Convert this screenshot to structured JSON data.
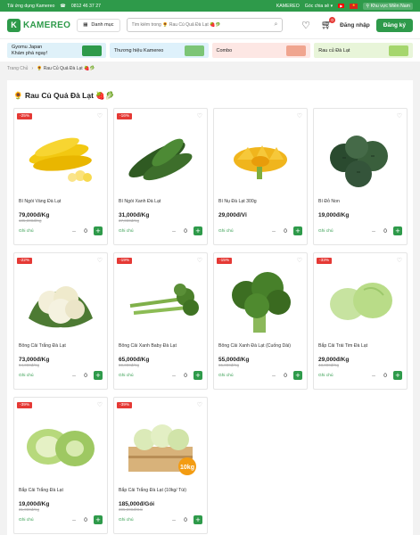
{
  "topbar": {
    "app_download": "Tải ứng dụng Kamereo",
    "phone": "0812 46 37 27",
    "brand": "KAMEREO",
    "corner": "Góc chia sẻ",
    "region": "Khu vực Miền Nam"
  },
  "header": {
    "logo_text": "KAMEREO",
    "menu_label": "Danh mục",
    "search_placeholder": "Tìm kiếm trong 🌻 Rau Củ Quả Đà Lạt 🍓🥬",
    "cart_count": "0",
    "login_label": "Đăng nhập",
    "register_label": "Đăng ký"
  },
  "banners": [
    {
      "line1": "Gyomu Japan",
      "line2": "Khám phá ngay!",
      "accent": "#2e9a4a"
    },
    {
      "line1": "Thương hiệu Kamereo",
      "line2": "",
      "accent": "#4caf50"
    },
    {
      "line1": "Combo",
      "line2": "",
      "accent": "#e57373"
    },
    {
      "line1": "Rau củ Đà Lạt",
      "line2": "",
      "accent": "#8bc34a"
    }
  ],
  "breadcrumb": {
    "home": "Trang Chủ",
    "current": "🌻 Rau Củ Quả Đà Lạt 🍓🥬"
  },
  "section_title": "🌻 Rau Củ Quả Đà Lạt 🍓🥬",
  "product_labels": {
    "note": "Ghi chú"
  },
  "products": [
    {
      "name": "Bí Ngòi Vàng Đà Lạt",
      "price": "79,000đ/Kg",
      "old_price": "105,000đ/Kg",
      "discount": "-25%",
      "qty": "0",
      "image": "yellow-zucchini"
    },
    {
      "name": "Bí Ngòi Xanh Đà Lạt",
      "price": "31,000đ/Kg",
      "old_price": "37,000đ/Kg",
      "discount": "-16%",
      "qty": "0",
      "image": "green-zucchini"
    },
    {
      "name": "Bí Nụ Đà Lạt 300g",
      "price": "29,000đ/Vỉ",
      "old_price": "",
      "discount": "",
      "qty": "0",
      "image": "squash-blossom"
    },
    {
      "name": "Bí Đỏ Non",
      "price": "19,000đ/Kg",
      "old_price": "",
      "discount": "",
      "qty": "0",
      "image": "round-squash"
    },
    {
      "name": "Bông Cải Trắng Đà Lạt",
      "price": "73,000đ/Kg",
      "old_price": "94,000đ/Kg",
      "discount": "-22%",
      "qty": "0",
      "image": "cauliflower"
    },
    {
      "name": "Bông Cải Xanh Baby Đà Lạt",
      "price": "65,000đ/Kg",
      "old_price": "80,000đ/Kg",
      "discount": "-19%",
      "qty": "0",
      "image": "baby-broccoli"
    },
    {
      "name": "Bông Cải Xanh Đà Lạt (Cuống Dài)",
      "price": "55,000đ/Kg",
      "old_price": "65,000đ/Kg",
      "discount": "-15%",
      "qty": "0",
      "image": "broccoli"
    },
    {
      "name": "Bắp Cải Trái Tim Đà Lạt",
      "price": "29,000đ/Kg",
      "old_price": "43,000đ/Kg",
      "discount": "-33%",
      "qty": "0",
      "image": "heart-cabbage"
    },
    {
      "name": "Bắp Cải Trắng Đà Lạt",
      "price": "19,000đ/Kg",
      "old_price": "31,000đ/Kg",
      "discount": "-39%",
      "qty": "0",
      "image": "white-cabbage"
    },
    {
      "name": "Bắp Cải Trắng Đà Lạt (10kg/ Túi)",
      "price": "185,000đ/Gói",
      "old_price": "305,000đ/Gói",
      "discount": "-39%",
      "qty": "0",
      "image": "cabbage-crate",
      "image_text": "10kg"
    }
  ]
}
